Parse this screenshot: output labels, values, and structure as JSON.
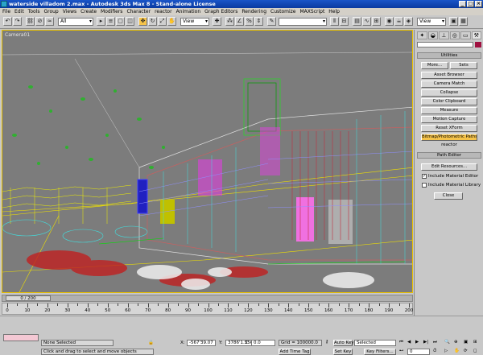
{
  "window": {
    "title": "waterside villadom 2.max - Autodesk 3ds Max 8 - Stand-alone License"
  },
  "menu": [
    "File",
    "Edit",
    "Tools",
    "Group",
    "Views",
    "Create",
    "Modifiers",
    "Character",
    "reactor",
    "Animation",
    "Graph Editors",
    "Rendering",
    "Customize",
    "MAXScript",
    "Help"
  ],
  "toolbar": {
    "filter_value": "All",
    "view_dropdown": "View",
    "view_dropdown2": "View"
  },
  "viewport": {
    "label": "Camera01"
  },
  "panel": {
    "tab_icons": [
      "create-icon",
      "modify-icon",
      "hierarchy-icon",
      "motion-icon",
      "display-icon",
      "utilities-icon"
    ],
    "utilities_header": "Utilities",
    "more_label": "More...",
    "sets_label": "Sets",
    "utilities": [
      "Asset Browser",
      "Camera Match",
      "Collapse",
      "Color Clipboard",
      "Measure",
      "Motion Capture",
      "Reset XForm",
      "Bitmap/Photometric Paths"
    ],
    "reactor_label": "reactor",
    "path_editor_header": "Path Editor",
    "edit_resources": "Edit Resources...",
    "include_material_editor": "Include Material Editor",
    "include_material_library": "Include Material Library",
    "close_label": "Close"
  },
  "timeline": {
    "frame_display": "0 / 200",
    "ticks": [
      0,
      10,
      20,
      30,
      40,
      50,
      60,
      70,
      80,
      90,
      100,
      110,
      120,
      130,
      140,
      150,
      160,
      170,
      180,
      190,
      200
    ]
  },
  "status": {
    "selection": "None Selected",
    "prompt": "Click and drag to select and move objects",
    "x_label": "X:",
    "x_value": "-567'39.07",
    "y_label": "Y:",
    "y_value": "3786'1.556",
    "z_label": "Z:",
    "z_value": "0.0",
    "grid": "Grid = 100000.0",
    "add_time_tag": "Add Time Tag",
    "auto_key": "Auto Key",
    "set_key": "Set Key",
    "key_filters": "Key Filters...",
    "selected_value": "Selected",
    "frame": "0"
  }
}
